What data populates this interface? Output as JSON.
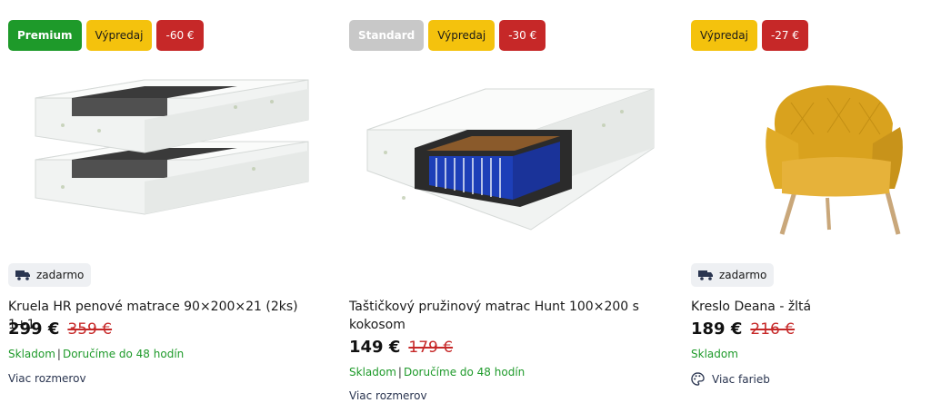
{
  "products": [
    {
      "badges": [
        "Premium",
        "Výpredaj",
        "-60 €"
      ],
      "delivery": "zadarmo",
      "title": "Kruela HR penové matrace 90×200×21 (2ks) 1+1",
      "price": "299 €",
      "old_price": "359 €",
      "stock": "Skladom",
      "delivery_time": "Doručíme do 48 hodín",
      "more": "Viac rozmerov"
    },
    {
      "badges": [
        "Standard",
        "Výpredaj",
        "-30 €"
      ],
      "title": "Taštičkový pružinový matrac Hunt 100×200 s kokosom",
      "price": "149 €",
      "old_price": "179 €",
      "stock": "Skladom",
      "delivery_time": "Doručíme do 48 hodín",
      "more": "Viac rozmerov"
    },
    {
      "badges": [
        "Výpredaj",
        "-27 €"
      ],
      "delivery": "zadarmo",
      "title": "Kreslo Deana - žltá",
      "price": "189 €",
      "old_price": "216 €",
      "stock": "Skladom",
      "more": "Viac farieb"
    }
  ],
  "colors": {
    "premium": "#1e9a2a",
    "sale": "#f4c20d",
    "discount": "#c62828",
    "chair": "#d9a21e"
  }
}
